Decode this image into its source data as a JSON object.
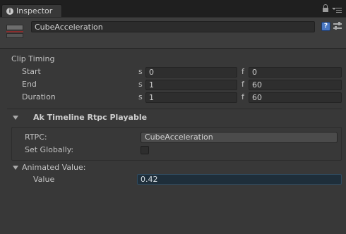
{
  "window": {
    "tab_label": "Inspector",
    "tab_icon": "info-icon"
  },
  "header": {
    "object_name": "CubeAcceleration",
    "help_glyph": "?"
  },
  "clip_timing": {
    "title": "Clip Timing",
    "rows": [
      {
        "label": "Start",
        "seconds_unit": "s",
        "seconds": "0",
        "frames_unit": "f",
        "frames": "0"
      },
      {
        "label": "End",
        "seconds_unit": "s",
        "seconds": "1",
        "frames_unit": "f",
        "frames": "60"
      },
      {
        "label": "Duration",
        "seconds_unit": "s",
        "seconds": "1",
        "frames_unit": "f",
        "frames": "60"
      }
    ]
  },
  "playable": {
    "title": "Ak Timeline Rtpc Playable",
    "rtpc_label": "RTPC:",
    "rtpc_value": "CubeAcceleration",
    "set_globally_label": "Set Globally:",
    "set_globally_checked": false
  },
  "animated_value": {
    "title": "Animated Value:",
    "value_label": "Value",
    "value": "0.42"
  },
  "colors": {
    "panel_bg": "#383838",
    "header_bg": "#3d3d3d",
    "help_icon": "#4a78c2",
    "object_stripe": "#8b2d2d",
    "animated_field": "#1e2e3a"
  }
}
